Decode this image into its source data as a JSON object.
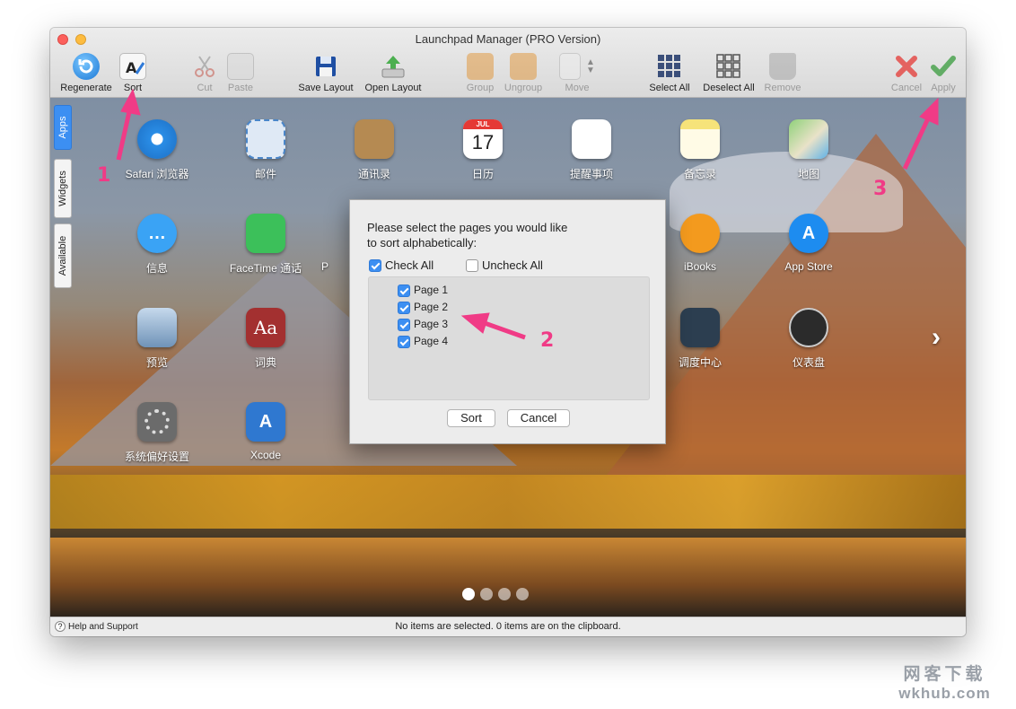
{
  "window": {
    "title": "Launchpad Manager (PRO Version)"
  },
  "toolbar": {
    "regenerate": "Regenerate",
    "sort": "Sort",
    "cut": "Cut",
    "paste": "Paste",
    "save_layout": "Save Layout",
    "open_layout": "Open Layout",
    "group": "Group",
    "ungroup": "Ungroup",
    "move": "Move",
    "select_all": "Select All",
    "deselect_all": "Deselect All",
    "remove": "Remove",
    "cancel": "Cancel",
    "apply": "Apply"
  },
  "side_tabs": {
    "apps": "Apps",
    "widgets": "Widgets",
    "available": "Available"
  },
  "apps": [
    {
      "label": "Safari 浏览器",
      "icon": "safari-icon",
      "color": "#2a8de6"
    },
    {
      "label": "邮件",
      "icon": "mail-icon",
      "color": "#4a86c9"
    },
    {
      "label": "通讯录",
      "icon": "contacts-icon",
      "color": "#b58a52"
    },
    {
      "label": "日历",
      "icon": "calendar-icon",
      "color": "#ffffff"
    },
    {
      "label": "提醒事项",
      "icon": "reminders-icon",
      "color": "#ffffff"
    },
    {
      "label": "备忘录",
      "icon": "notes-icon",
      "color": "#f6e37a"
    },
    {
      "label": "地图",
      "icon": "maps-icon",
      "color": "#7fc06a"
    },
    {
      "label": "信息",
      "icon": "messages-icon",
      "color": "#3aa3f5"
    },
    {
      "label": "FaceTime 通话",
      "icon": "facetime-icon",
      "color": "#3cc05a"
    },
    {
      "label": "P",
      "icon": "photo-booth-icon",
      "color": "#c0392b"
    },
    {
      "label": "iBooks",
      "icon": "ibooks-icon",
      "color": "#f39a1e"
    },
    {
      "label": "App Store",
      "icon": "app-store-icon",
      "color": "#1d8cf0"
    },
    {
      "label": "预览",
      "icon": "preview-icon",
      "color": "#8aa7c4"
    },
    {
      "label": "词典",
      "icon": "dictionary-icon",
      "color": "#a33030"
    },
    {
      "label": "调度中心",
      "icon": "mission-control-icon",
      "color": "#2c3e50"
    },
    {
      "label": "仪表盘",
      "icon": "dashboard-icon",
      "color": "#2b2b2b"
    },
    {
      "label": "系统偏好设置",
      "icon": "system-preferences-icon",
      "color": "#6b6b6b"
    },
    {
      "label": "Xcode",
      "icon": "xcode-icon",
      "color": "#2f78d0"
    }
  ],
  "dialog": {
    "prompt_line1": "Please select the pages you would like",
    "prompt_line2": "to sort alphabetically:",
    "check_all": "Check All",
    "uncheck_all": "Uncheck All",
    "pages": [
      "Page 1",
      "Page 2",
      "Page 3",
      "Page 4"
    ],
    "sort_button": "Sort",
    "cancel_button": "Cancel"
  },
  "status": {
    "help": "Help and Support",
    "message": "No items are selected. 0 items are on the clipboard."
  },
  "annotations": {
    "step1": "1",
    "step2": "2",
    "step3": "3"
  },
  "watermark": {
    "line1": "网客下载",
    "line2": "wkhub.com"
  }
}
